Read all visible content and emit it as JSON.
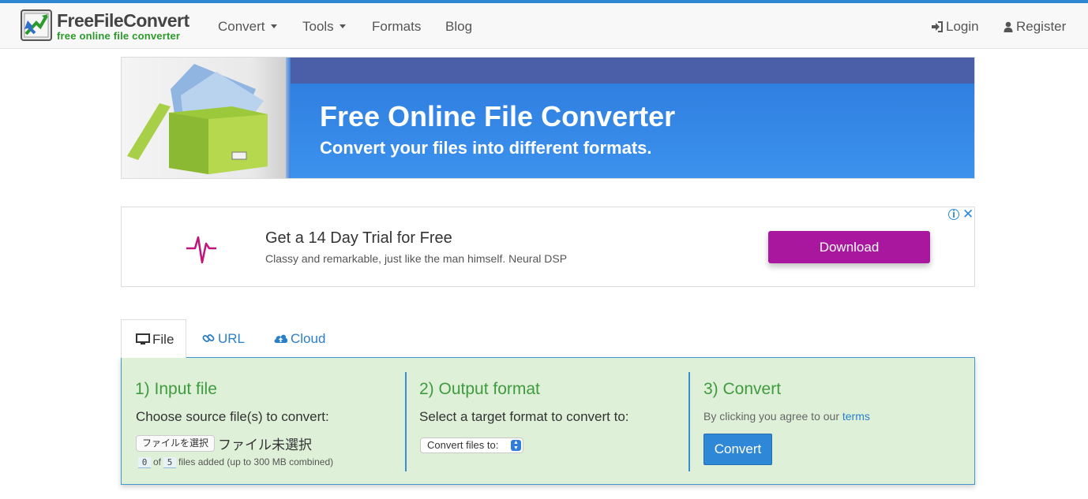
{
  "navbar": {
    "logo_title": "FreeFileConvert",
    "logo_subtitle": "free online file converter",
    "menu": {
      "convert": "Convert",
      "tools": "Tools",
      "formats": "Formats",
      "blog": "Blog"
    },
    "login": "Login",
    "register": "Register"
  },
  "hero": {
    "title": "Free Online File Converter",
    "subtitle": "Convert your files into different formats."
  },
  "ad": {
    "title": "Get a 14 Day Trial for Free",
    "description": "Classy and remarkable, just like the man himself. Neural DSP",
    "button": "Download",
    "info": "i",
    "close": "✕",
    "accent_color": "#a8179e"
  },
  "tabs": {
    "file": "File",
    "url": "URL",
    "cloud": "Cloud"
  },
  "converter": {
    "step1": {
      "title": "1) Input file",
      "text": "Choose source file(s) to convert:",
      "file_button": "ファイルを選択",
      "file_status": "ファイル未選択",
      "count_current": "0",
      "count_of": "of",
      "count_max": "5",
      "count_suffix": "files added (up to 300 MB combined)"
    },
    "step2": {
      "title": "2) Output format",
      "text": "Select a target format to convert to:",
      "select_value": "Convert files to:"
    },
    "step3": {
      "title": "3) Convert",
      "terms_prefix": "By clicking you agree to our",
      "terms_link": "terms",
      "button": "Convert"
    },
    "colors": {
      "panel_bg": "#dff0d8",
      "title_green": "#3f9b3f",
      "link_blue": "#2a7fc9"
    }
  }
}
